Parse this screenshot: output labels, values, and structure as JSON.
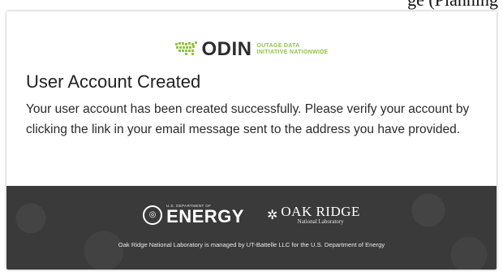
{
  "top_strip": {
    "text": "ge (Planning"
  },
  "header": {
    "logo_word": "ODIN",
    "logo_sub_line1": "OUTAGE DATA",
    "logo_sub_line2": "INITIATIVE NATIONWIDE"
  },
  "main": {
    "title": "User Account Created",
    "message": "Your user account has been created successfully. Please verify your account by clicking the link in your email message sent to the address you have provided."
  },
  "footer": {
    "doe_small": "U.S. DEPARTMENT OF",
    "doe_big": "ENERGY",
    "ornl_name": "OAK RIDGE",
    "ornl_sub": "National Laboratory",
    "management_text": "Oak Ridge National Laboratory is managed by UT-Battelle LLC for the U.S. Department of Energy"
  },
  "colors": {
    "accent_green": "#8cc63f",
    "footer_bg": "#3a3a3a",
    "title_text": "#222222"
  },
  "icons": [
    "us-map-icon",
    "doe-seal-icon",
    "ornl-leaf-icon"
  ]
}
